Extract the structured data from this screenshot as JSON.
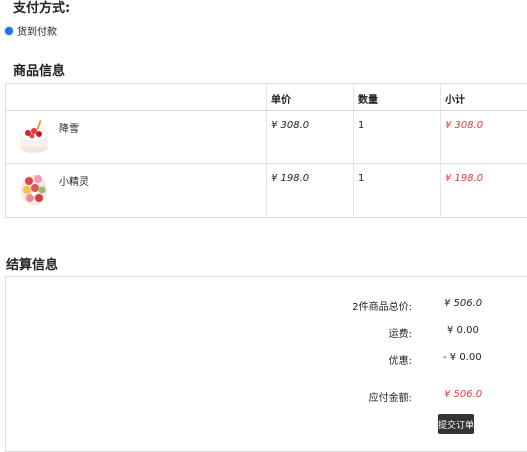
{
  "payment": {
    "title": "支付方式:",
    "option": "货到付款"
  },
  "goods": {
    "title": "商品信息",
    "headers": {
      "price": "单价",
      "qty": "数量",
      "subtotal": "小计"
    },
    "rows": [
      {
        "name": "降雪",
        "price": "¥ 308.0",
        "qty": "1",
        "subtotal": "¥ 308.0"
      },
      {
        "name": "小精灵",
        "price": "¥ 198.0",
        "qty": "1",
        "subtotal": "¥ 198.0"
      }
    ]
  },
  "settlement": {
    "title": "结算信息",
    "total_label": "2件商品总价:",
    "total_value": "¥ 506.0",
    "shipping_label": "运费:",
    "shipping_value": "¥ 0.00",
    "discount_label": "优惠:",
    "discount_value": "- ¥ 0.00",
    "payable_label": "应付金额:",
    "payable_value": "¥ 506.0",
    "submit_label": "提交订单"
  },
  "colors": {
    "accent_red": "#e4393c",
    "radio_blue": "#1a73e8",
    "button_bg": "#333333"
  },
  "icons": {
    "row1": "cake-strawberry-image",
    "row2": "cake-flowers-image"
  }
}
